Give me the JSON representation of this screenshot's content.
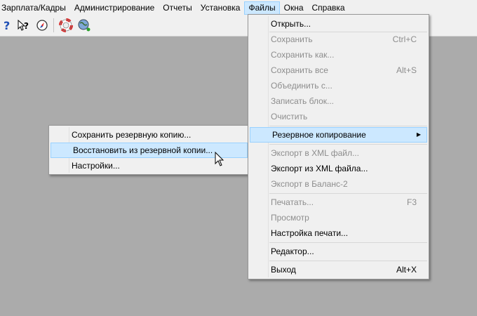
{
  "menubar": {
    "items": [
      "Зарплата/Кадры",
      "Администрирование",
      "Отчеты",
      "Установка",
      "Файлы",
      "Окна",
      "Справка"
    ]
  },
  "toolbar": {
    "icons": [
      "help-icon",
      "context-help-icon",
      "compass-icon",
      "lifebuoy-icon",
      "globe-icon"
    ]
  },
  "files_menu": {
    "items": [
      {
        "label": "Открыть...",
        "shortcut": "",
        "enabled": true
      },
      {
        "label": "Сохранить",
        "shortcut": "Ctrl+C",
        "enabled": false
      },
      {
        "label": "Сохранить как...",
        "shortcut": "",
        "enabled": false
      },
      {
        "label": "Сохранить все",
        "shortcut": "Alt+S",
        "enabled": false
      },
      {
        "label": "Объединить с...",
        "shortcut": "",
        "enabled": false
      },
      {
        "label": "Записать блок...",
        "shortcut": "",
        "enabled": false
      },
      {
        "label": "Очистить",
        "shortcut": "",
        "enabled": false
      },
      {
        "label": "Резервное копирование",
        "shortcut": "",
        "enabled": true,
        "submenu": true,
        "highlighted": true
      },
      {
        "label": "Экспорт в XML файл...",
        "shortcut": "",
        "enabled": false
      },
      {
        "label": "Экспорт из XML файла...",
        "shortcut": "",
        "enabled": true
      },
      {
        "label": "Экспорт в Баланс-2",
        "shortcut": "",
        "enabled": false
      },
      {
        "label": "Печатать...",
        "shortcut": "F3",
        "enabled": false
      },
      {
        "label": "Просмотр",
        "shortcut": "",
        "enabled": false
      },
      {
        "label": "Настройка печати...",
        "shortcut": "",
        "enabled": true
      },
      {
        "label": "Редактор...",
        "shortcut": "",
        "enabled": true
      },
      {
        "label": "Выход",
        "shortcut": "Alt+X",
        "enabled": true
      }
    ]
  },
  "backup_submenu": {
    "items": [
      {
        "label": "Сохранить резервную копию...",
        "highlighted": false
      },
      {
        "label": "Восстановить из резервной копии...",
        "highlighted": true
      },
      {
        "label": "Настройки...",
        "highlighted": false
      }
    ]
  },
  "colors": {
    "desktop": "#ababab",
    "menu_bg": "#f0f0f0",
    "highlight": "#cce8ff",
    "highlight_border": "#99d1ff",
    "disabled_text": "#8d8d8d"
  }
}
